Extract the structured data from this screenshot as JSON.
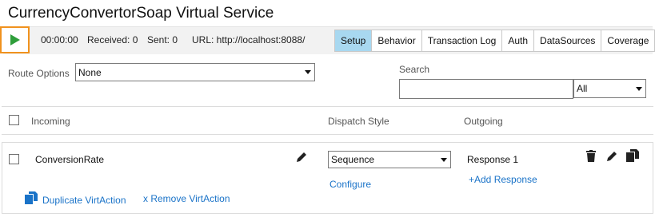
{
  "window": {
    "title": "CurrencyConvertorSoap Virtual Service"
  },
  "toolbar": {
    "play_icon": "play-icon",
    "time": "00:00:00",
    "received": "Received: 0",
    "sent": "Sent: 0",
    "url": "URL: http://localhost:8088/",
    "tabs": [
      {
        "label": "Setup",
        "active": true
      },
      {
        "label": "Behavior"
      },
      {
        "label": "Transaction Log"
      },
      {
        "label": "Auth"
      },
      {
        "label": "DataSources"
      },
      {
        "label": "Coverage"
      }
    ]
  },
  "options": {
    "route_label": "Route Options",
    "route_value": "None",
    "search_label": "Search",
    "search_value": "",
    "filter_value": "All"
  },
  "table": {
    "headers": {
      "incoming": "Incoming",
      "dispatch": "Dispatch Style",
      "outgoing": "Outgoing"
    },
    "rows": [
      {
        "incoming": "ConversionRate",
        "dispatch": "Sequence",
        "configure": "Configure",
        "response": "Response 1",
        "add_response": "+Add Response",
        "duplicate": "Duplicate VirtAction",
        "remove": "x Remove VirtAction"
      }
    ]
  },
  "colors": {
    "accent": "#1a73c8",
    "play": "#2e9e3a",
    "highlight": "#f0921e",
    "active_tab": "#a8d8f0"
  }
}
